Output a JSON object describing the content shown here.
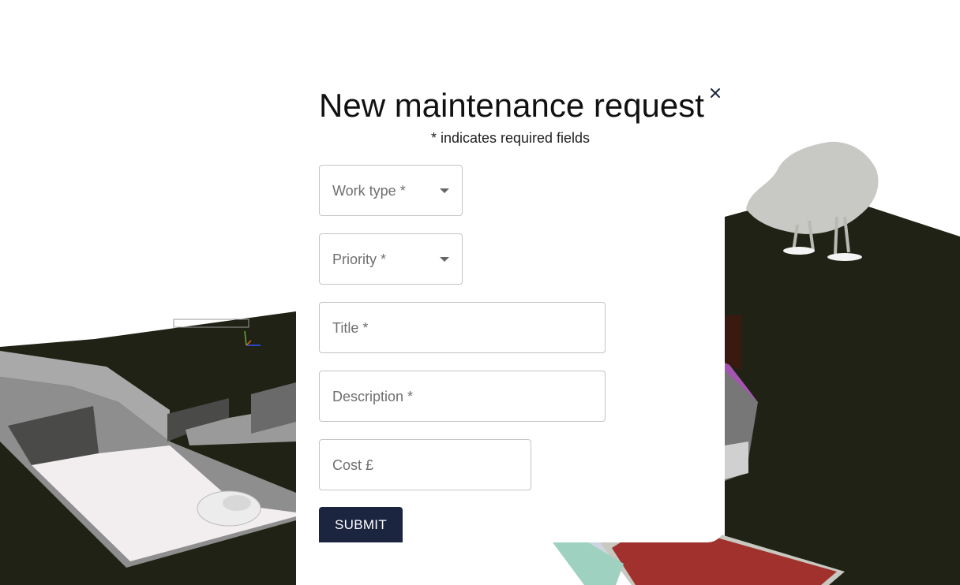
{
  "modal": {
    "title": "New maintenance request",
    "subtitle": "* indicates required fields",
    "close_icon": "close-icon"
  },
  "form": {
    "work_type": {
      "placeholder": "Work type *",
      "icon": "chevron-down-icon"
    },
    "priority": {
      "placeholder": "Priority *",
      "icon": "chevron-down-icon"
    },
    "title": {
      "placeholder": "Title *"
    },
    "description": {
      "placeholder": "Description *"
    },
    "cost": {
      "placeholder": "Cost £"
    },
    "submit_label": "SUBMIT"
  },
  "colors": {
    "submit_background": "#1c2540",
    "scene_ground": "#1f2214",
    "driveway": "#f2eef0",
    "patio": "#a0312c",
    "tree": "#c8c8c4"
  }
}
